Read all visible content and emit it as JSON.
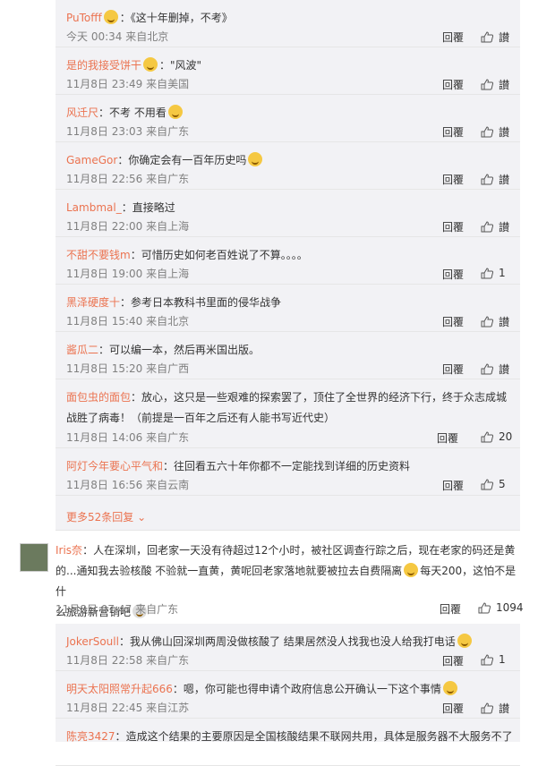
{
  "replies": [
    {
      "user": "PuTofff",
      "text": "《这十年删掉，不考》",
      "emoji_after_user": true,
      "meta": "今天 00:34 来自北京",
      "reply_label": "回覆",
      "like_label": "讃"
    },
    {
      "user": "是的我接受饼干",
      "text": "\"风波\"",
      "emoji_after_user": true,
      "meta": "11月8日 23:49 来自美国",
      "reply_label": "回覆",
      "like_label": "讃"
    },
    {
      "user": "风迁尺",
      "text": "不考 不用看",
      "emoji_after_text": true,
      "meta": "11月8日 23:03 来自广东",
      "reply_label": "回覆",
      "like_label": "讃"
    },
    {
      "user": "GameGor",
      "text": "你确定会有一百年历史吗",
      "emoji_after_text": true,
      "meta": "11月8日 22:56 来自广东",
      "reply_label": "回覆",
      "like_label": "讃"
    },
    {
      "user": "Lambmal_",
      "text": "直接略过",
      "meta": "11月8日 22:00 来自上海",
      "reply_label": "回覆",
      "like_label": "讃"
    },
    {
      "user": "不甜不要钱m",
      "text": "可惜历史如何老百姓说了不算。。。。",
      "meta": "11月8日 19:00 来自上海",
      "reply_label": "回覆",
      "like_label": "1"
    },
    {
      "user": "黑泽硬度十",
      "text": "参考日本教科书里面的侵华战争",
      "meta": "11月8日 15:40 来自北京",
      "reply_label": "回覆",
      "like_label": "讃"
    },
    {
      "user": "酱瓜二",
      "text": "可以编一本，然后再米国出版。",
      "meta": "11月8日 15:20 来自广西",
      "reply_label": "回覆",
      "like_label": "讃"
    },
    {
      "user": "面包虫的面包",
      "text": "放心，这只是一些艰难的探索罢了，顶住了全世界的经济下行，终于众志成城",
      "text2": "战胜了病毒！（前提是一百年之后还有人能书写近代史）",
      "meta": "11月8日 14:06 来自广东",
      "reply_label": "回覆",
      "like_label": "20"
    },
    {
      "user": "阿灯今年要心平气和",
      "text": "往回看五六十年你都不一定能找到详细的历史资料",
      "meta": "11月8日 16:56 来自云南",
      "reply_label": "回覆",
      "like_label": "5"
    }
  ],
  "more_replies": "更多52条回复",
  "main_comment": {
    "user": "Iris奈",
    "text1": "人在深圳，回老家一天没有待超过12个小时，被社区调查行踪之后，现在老家的码还是黄",
    "text2": "的...通知我去验核酸 不验就一直黄，黄呢回老家落地就要被拉去自费隔离",
    "text2b": "每天200，这怕不是什",
    "text3": "么旅游新营销吧",
    "meta": "11月8日 07:47 来自广东",
    "reply_label": "回覆",
    "like_label": "1094"
  },
  "subreplies": [
    {
      "user": "JokerSoull",
      "text": "我从佛山回深圳两周没做核酸了 结果居然没人找我也没人给我打电话",
      "meta": "11月8日 22:58 来自广东",
      "reply_label": "回覆",
      "like_label": "1"
    },
    {
      "user": "明天太阳照常升起666",
      "text": "嗯，你可能也得申请个政府信息公开确认一下这个事情",
      "meta": "11月8日 22:45 来自江苏",
      "reply_label": "回覆",
      "like_label": "讃"
    },
    {
      "user": "陈亮3427",
      "text": "造成这个结果的主要原因是全国核酸结果不联网共用，具体是服务器不大服务不了"
    }
  ],
  "colors": {
    "username": "#eb7350",
    "meta": "#808080",
    "panel": "#f2f2f5"
  }
}
